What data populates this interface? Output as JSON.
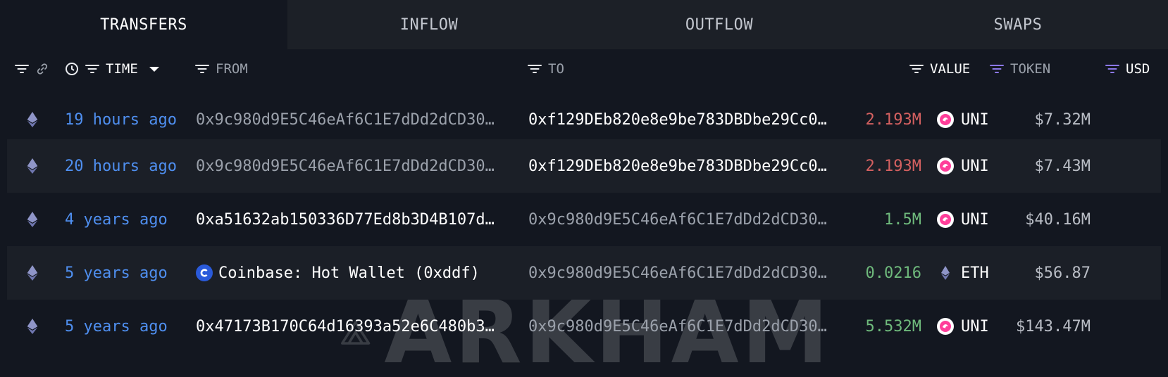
{
  "tabs": [
    {
      "label": "TRANSFERS"
    },
    {
      "label": "INFLOW"
    },
    {
      "label": "OUTFLOW"
    },
    {
      "label": "SWAPS"
    }
  ],
  "header": {
    "time": "TIME",
    "from": "FROM",
    "to": "TO",
    "value": "VALUE",
    "token": "TOKEN",
    "usd": "USD"
  },
  "rows": [
    {
      "time": "19 hours ago",
      "from": "0x9c980d9E5C46eAf6C1E7dDd2dCD30…",
      "from_style": "dim",
      "to": "0xf129DEb820e8e9be783DBDbe29Cc0…",
      "to_style": "bright",
      "value": "2.193M",
      "value_color": "red",
      "token": "UNI",
      "usd": "$7.32M"
    },
    {
      "time": "20 hours ago",
      "from": "0x9c980d9E5C46eAf6C1E7dDd2dCD30…",
      "from_style": "dim",
      "to": "0xf129DEb820e8e9be783DBDbe29Cc0…",
      "to_style": "bright",
      "value": "2.193M",
      "value_color": "red",
      "token": "UNI",
      "usd": "$7.43M"
    },
    {
      "time": "4 years ago",
      "from": "0xa51632ab150336D77Ed8b3D4B107d…",
      "from_style": "bright",
      "to": "0x9c980d9E5C46eAf6C1E7dDd2dCD30…",
      "to_style": "dim",
      "value": "1.5M",
      "value_color": "green",
      "token": "UNI",
      "usd": "$40.16M"
    },
    {
      "time": "5 years ago",
      "from": "Coinbase: Hot Wallet (0xddf)",
      "from_style": "bright",
      "to": "0x9c980d9E5C46eAf6C1E7dDd2dCD30…",
      "to_style": "dim",
      "value": "0.0216",
      "value_color": "green",
      "token": "ETH",
      "usd": "$56.87"
    },
    {
      "time": "5 years ago",
      "from": "0x47173B170C64d16393a52e6C480b3…",
      "from_style": "bright",
      "to": "0x9c980d9E5C46eAf6C1E7dDd2dCD30…",
      "to_style": "dim",
      "value": "5.532M",
      "value_color": "green",
      "token": "UNI",
      "usd": "$143.47M"
    }
  ],
  "watermark": "ARKHAM",
  "colors": {
    "background": "#131720",
    "tab_inactive": "#1c2027",
    "time_link": "#4f8ff0",
    "value_out": "#d46060",
    "value_in": "#6fba7c",
    "filter_accent": "#8b77e6"
  }
}
